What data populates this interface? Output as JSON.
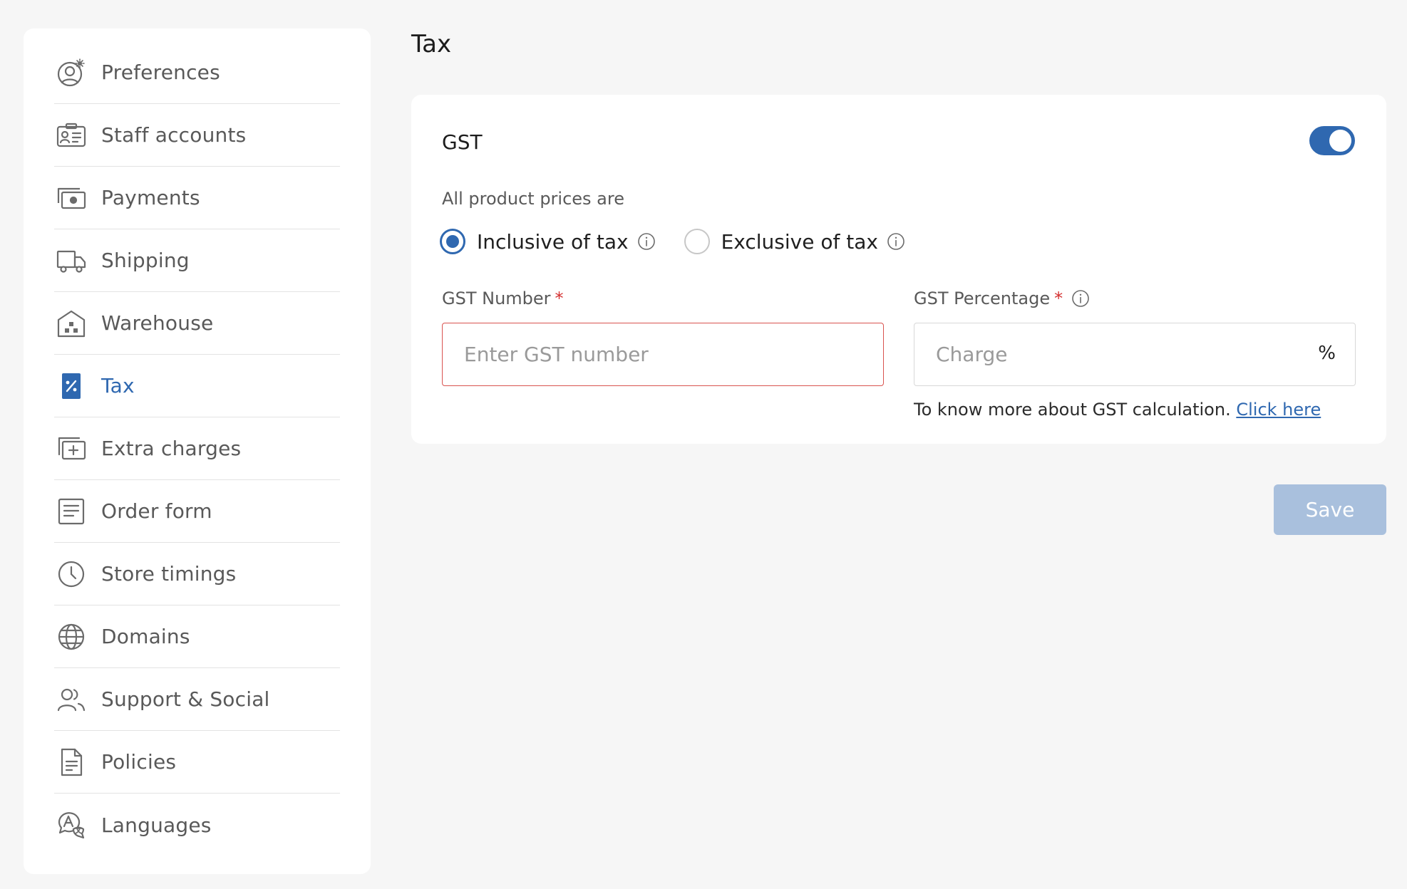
{
  "sidebar": {
    "items": [
      {
        "label": "Preferences",
        "icon": "user-settings-icon",
        "active": false
      },
      {
        "label": "Staff accounts",
        "icon": "id-card-icon",
        "active": false
      },
      {
        "label": "Payments",
        "icon": "cash-icon",
        "active": false
      },
      {
        "label": "Shipping",
        "icon": "truck-icon",
        "active": false
      },
      {
        "label": "Warehouse",
        "icon": "warehouse-icon",
        "active": false
      },
      {
        "label": "Tax",
        "icon": "percent-tag-icon",
        "active": true
      },
      {
        "label": "Extra charges",
        "icon": "add-charges-icon",
        "active": false
      },
      {
        "label": "Order form",
        "icon": "form-icon",
        "active": false
      },
      {
        "label": "Store timings",
        "icon": "clock-icon",
        "active": false
      },
      {
        "label": "Domains",
        "icon": "globe-icon",
        "active": false
      },
      {
        "label": "Support & Social",
        "icon": "users-icon",
        "active": false
      },
      {
        "label": "Policies",
        "icon": "document-icon",
        "active": false
      },
      {
        "label": "Languages",
        "icon": "translate-icon",
        "active": false
      }
    ]
  },
  "page": {
    "title": "Tax"
  },
  "gst": {
    "title": "GST",
    "enabled": true,
    "prices_label": "All product prices are",
    "options": [
      {
        "label": "Inclusive of tax",
        "selected": true
      },
      {
        "label": "Exclusive of tax",
        "selected": false
      }
    ],
    "number_label": "GST Number",
    "number_placeholder": "Enter GST number",
    "number_value": "",
    "percentage_label": "GST Percentage",
    "percentage_placeholder": "Charge",
    "percentage_value": "",
    "percentage_suffix": "%",
    "required_mark": "*",
    "help_text": "To know more about GST calculation.",
    "help_link": "Click here"
  },
  "actions": {
    "save_label": "Save"
  },
  "colors": {
    "accent": "#2f68b0",
    "error": "#d9534f",
    "save_disabled": "#a9c0dd",
    "background": "#f6f6f6"
  }
}
